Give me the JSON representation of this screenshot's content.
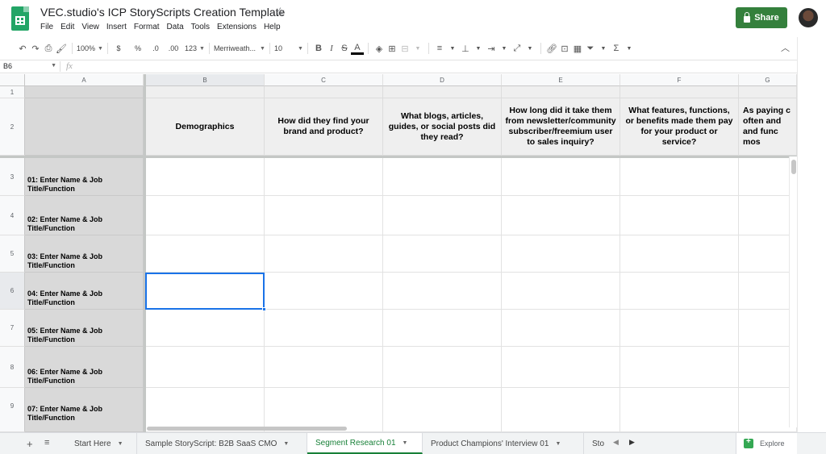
{
  "document": {
    "title": "VEC.studio's ICP StoryScripts Creation Template"
  },
  "menu": [
    "File",
    "Edit",
    "View",
    "Insert",
    "Format",
    "Data",
    "Tools",
    "Extensions",
    "Help"
  ],
  "share": {
    "label": "Share"
  },
  "toolbar": {
    "zoom": "100%",
    "currency": "$",
    "percent": "%",
    "decrease_decimal": ".0",
    "increase_decimal": ".00",
    "more_formats": "123",
    "font": "Merriweath...",
    "font_size": "10"
  },
  "formula_bar": {
    "cell_ref": "B6",
    "fx": "fx",
    "value": ""
  },
  "columns": [
    "A",
    "B",
    "C",
    "D",
    "E",
    "F",
    "G"
  ],
  "rows": [
    "1",
    "2",
    "3",
    "4",
    "5",
    "6",
    "7",
    "8",
    "9"
  ],
  "header_questions": [
    "Demographics",
    "How did they find your brand and product?",
    "What blogs, articles, guides, or social posts did they read?",
    "How long did it take them from newsletter/community subscriber/freemium user to sales inquiry?",
    "What features, functions, or benefits made them pay for your product or service?",
    "As paying c often and and func mos"
  ],
  "personas": [
    "01: Enter Name & Job Title/Function",
    "02: Enter Name & Job Title/Function",
    "03: Enter Name & Job Title/Function",
    "04: Enter Name & Job Title/Function",
    "05: Enter Name & Job Title/Function",
    "06: Enter Name & Job Title/Function",
    "07: Enter Name & Job Title/Function"
  ],
  "sheets": [
    {
      "label": "Start Here",
      "active": false
    },
    {
      "label": "Sample StoryScript: B2B SaaS CMO",
      "active": false
    },
    {
      "label": "Segment Research 01",
      "active": true
    },
    {
      "label": "Product Champions' Interview 01",
      "active": false
    },
    {
      "label": "Sto",
      "active": false
    }
  ],
  "explore": {
    "label": "Explore"
  },
  "colors": {
    "accent_green": "#188038",
    "share_green": "#34803c",
    "selection_blue": "#1a73e8"
  }
}
